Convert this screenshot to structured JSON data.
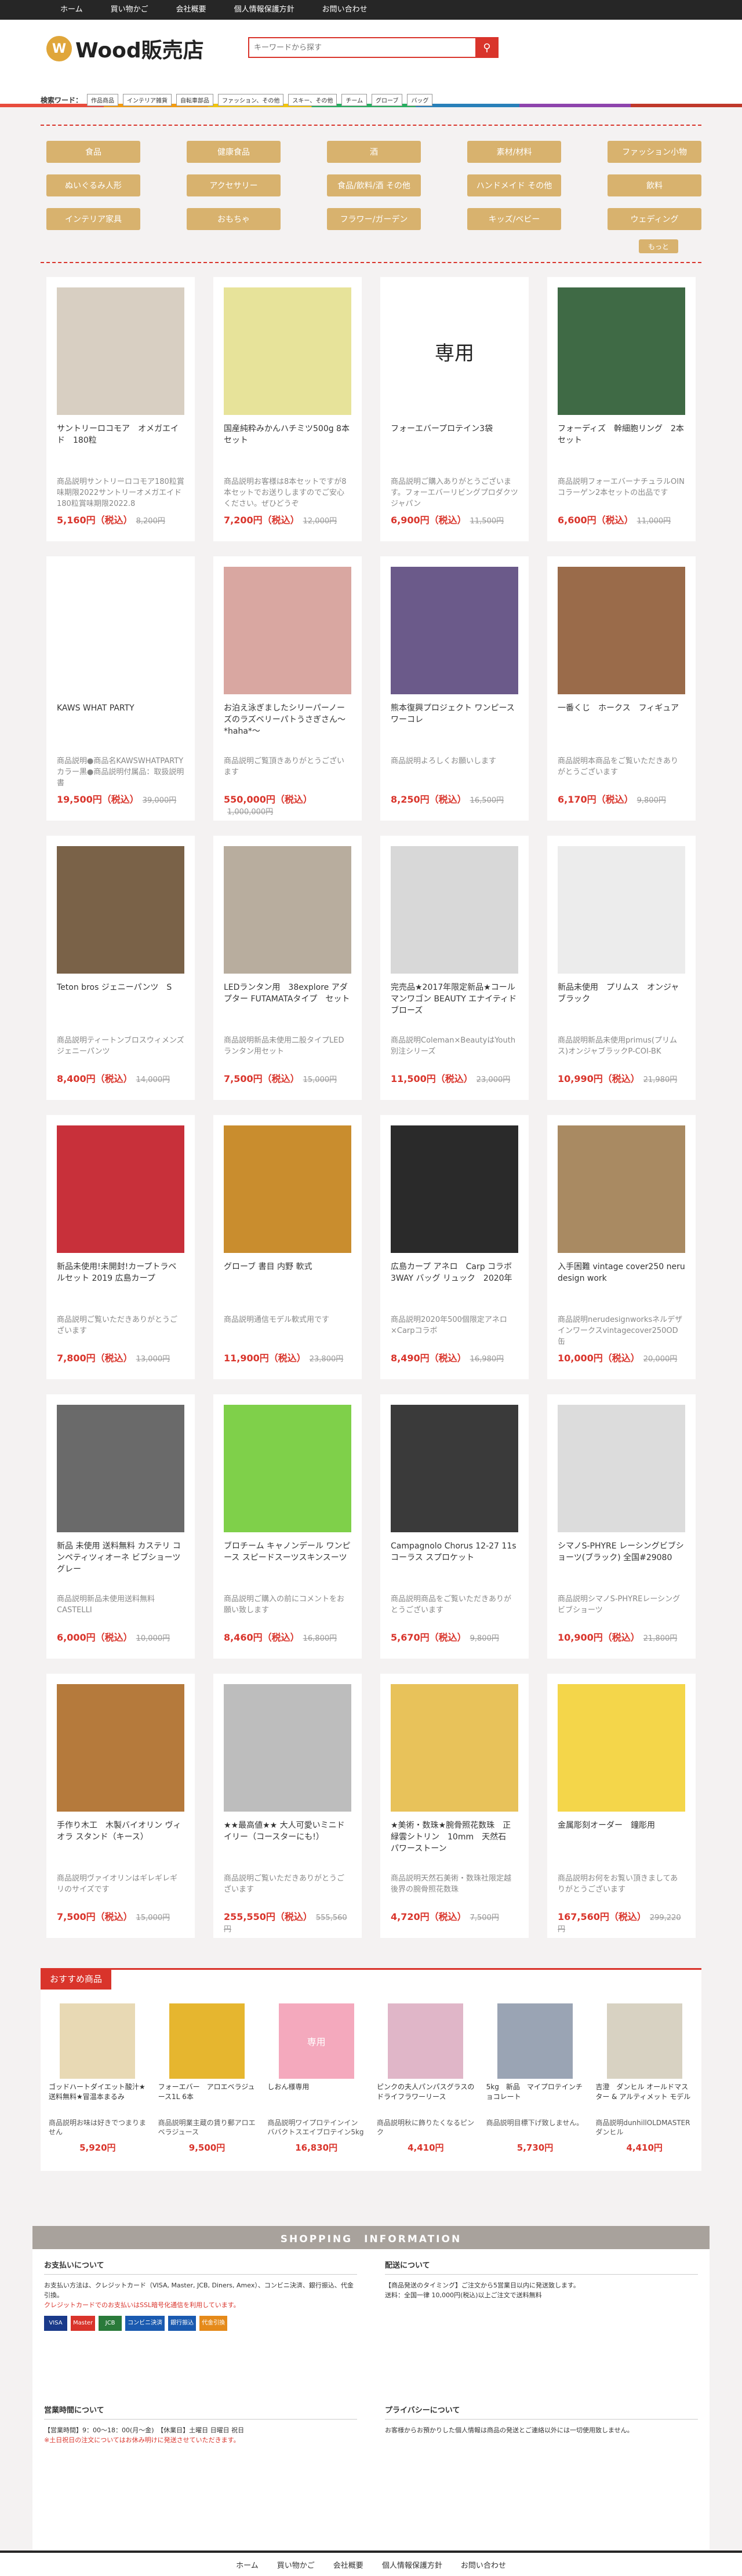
{
  "nav": [
    "ホーム",
    "買い物かご",
    "会社概要",
    "個人情報保護方針",
    "お問い合わせ"
  ],
  "logo": {
    "icon": "W",
    "text": "Wood販売店"
  },
  "search": {
    "placeholder": "キーワードから探す",
    "button_icon": "search-icon"
  },
  "keywords": {
    "label": "検索ワード：",
    "items": [
      "作品商品",
      "インテリア雑貨",
      "自転車部品",
      "ファッション、その他",
      "スキー、その他",
      "チーム",
      "グローブ",
      "バッグ"
    ]
  },
  "categories": [
    "食品",
    "健康食品",
    "酒",
    "素材/材料",
    "ファッション小物",
    "ぬいぐるみ人形",
    "アクセサリー",
    "食品/飲料/酒 その他",
    "ハンドメイド その他",
    "飲料",
    "インテリア家具",
    "おもちゃ",
    "フラワー/ガーデン",
    "キッズ/ベビー",
    "ウェディング"
  ],
  "more_label": "もっと",
  "products": [
    {
      "name": "サントリーロコモア　オメガエイド　180粒",
      "desc": "商品説明サントリーロコモア180粒賞味期限2022サントリーオメガエイド180粒賞味期限2022.8",
      "price": "5,160円（税込）",
      "orig": "8,200円",
      "color": "#d8cfc2"
    },
    {
      "name": "国産純粋みかんハチミツ500g 8本セット",
      "desc": "商品説明お客様は8本セットですが8本セットでお送りしますのでご安心ください。ぜひどうぞ",
      "price": "7,200円（税込）",
      "orig": "12,000円",
      "color": "#e7e39a"
    },
    {
      "name": "フォーエバープロテイン3袋",
      "desc": "商品説明ご購入ありがとうございます。フォーエバーリビングプロダクツジャパン",
      "price": "6,900円（税込）",
      "orig": "11,500円",
      "color": "#ffffff",
      "label": "専用"
    },
    {
      "name": "フォーディズ　幹細胞リング　2本セット",
      "desc": "商品説明フォーエバーナチュラルOINコラーゲン2本セットの出品です",
      "price": "6,600円（税込）",
      "orig": "11,000円",
      "color": "#3f6a45"
    },
    {
      "name": "KAWS WHAT PARTY",
      "desc": "商品説明●商品名KAWSWHATPARTYカラー黒●商品説明付属品：取扱説明書",
      "price": "19,500円（税込）",
      "orig": "39,000円",
      "color": "#ffffff"
    },
    {
      "name": "お泊え泳ぎましたシリーパーノーズのラズベリーパトうさぎさん〜*haha*〜",
      "desc": "商品説明ご覧頂きありがとうございます",
      "price": "550,000円（税込）",
      "orig": "1,000,000円",
      "color": "#d9a7a1"
    },
    {
      "name": "熊本復興プロジェクト ワンピース ワーコレ",
      "desc": "商品説明よろしくお願いします",
      "price": "8,250円（税込）",
      "orig": "16,500円",
      "color": "#6b5a8a"
    },
    {
      "name": "一番くじ　ホークス　フィギュア",
      "desc": "商品説明本商品をご覧いただきありがとうございます",
      "price": "6,170円（税込）",
      "orig": "9,800円",
      "color": "#9a6b4a"
    },
    {
      "name": "Teton bros ジェニーパンツ　S",
      "desc": "商品説明ティートンブロスウィメンズジェニーパンツ",
      "price": "8,400円（税込）",
      "orig": "14,000円",
      "color": "#7a6248"
    },
    {
      "name": "LEDランタン用　38explore アダプター FUTAMATAタイプ　セット",
      "desc": "商品説明新品未使用二股タイプLEDランタン用セット",
      "price": "7,500円（税込）",
      "orig": "15,000円",
      "color": "#b8ad9e"
    },
    {
      "name": "完売品★2017年限定新品★コールマンワゴン BEAUTY エナイティドブローズ",
      "desc": "商品説明Coleman×BeautyはYouth別注シリーズ",
      "price": "11,500円（税込）",
      "orig": "23,000円",
      "color": "#d8d8d8"
    },
    {
      "name": "新品未使用　プリムス　オンジャ　ブラック",
      "desc": "商品説明新品未使用primus(プリムス)オンジャブラックP-COI-BK",
      "price": "10,990円（税込）",
      "orig": "21,980円",
      "color": "#ececec"
    },
    {
      "name": "新品未使用!未開封!カープトラベルセット 2019 広島カープ",
      "desc": "商品説明ご覧いただきありがとうございます",
      "price": "7,800円（税込）",
      "orig": "13,000円",
      "color": "#c8303a"
    },
    {
      "name": "グローブ 書目 内野 軟式",
      "desc": "商品説明通信モデル軟式用です",
      "price": "11,900円（税込）",
      "orig": "23,800円",
      "color": "#c98d2e"
    },
    {
      "name": "広島カープ アネロ　Carp コラボ 3WAY バッグ リュック　2020年",
      "desc": "商品説明2020年500個限定アネロ×Carpコラボ",
      "price": "8,490円（税込）",
      "orig": "16,980円",
      "color": "#2a2a2a"
    },
    {
      "name": "入手困難 vintage cover250 neru design work",
      "desc": "商品説明nerudesignworksネルデザインワークスvintagecover250OD缶",
      "price": "10,000円（税込）",
      "orig": "20,000円",
      "color": "#a98a62"
    },
    {
      "name": "新品 未使用 送料無料 カステリ コンペティツィオーネ ビブショーツ グレー",
      "desc": "商品説明新品未使用送料無料CASTELLI",
      "price": "6,000円（税込）",
      "orig": "10,000円",
      "color": "#6a6a6a"
    },
    {
      "name": "ブロチーム キャノンデール ワンピース スピードスーツスキンスーツ",
      "desc": "商品説明ご購入の前にコメントをお願い致します",
      "price": "8,460円（税込）",
      "orig": "16,800円",
      "color": "#7fd04a"
    },
    {
      "name": "Campagnolo Chorus 12-27 11s コーラス スプロケット",
      "desc": "商品説明商品をご覧いただきありがとうございます",
      "price": "5,670円（税込）",
      "orig": "9,800円",
      "color": "#3a3a3a"
    },
    {
      "name": "シマノS-PHYRE レーシングビブショーツ(ブラック) 全国#29080",
      "desc": "商品説明シマノS-PHYREレーシングビブショーツ",
      "price": "10,900円（税込）",
      "orig": "21,800円",
      "color": "#dcdcdc"
    },
    {
      "name": "手作り木工　木製バイオリン ヴィオラ スタンド（キース）",
      "desc": "商品説明ヴァイオリンはギレギレギリのサイズです",
      "price": "7,500円（税込）",
      "orig": "15,000円",
      "color": "#b57a3c"
    },
    {
      "name": "★★最高値★★ 大人可愛いミニドイリー（コースターにも!）",
      "desc": "商品説明ご覧いただきありがとうございます",
      "price": "255,550円（税込）",
      "orig": "555,560円",
      "color": "#bdbdbd"
    },
    {
      "name": "★美術・数珠★腕骨照花数珠　正緑雲シトリン　10mm　天然石　パワーストーン",
      "desc": "商品説明天然石美術・数珠社限定越後界の腕骨照花数珠",
      "price": "4,720円（税込）",
      "orig": "7,500円",
      "color": "#e8c25a"
    },
    {
      "name": "金属彫刻オーダー　鐘彫用",
      "desc": "商品説明お何をお覧い頂きましてありがとうございます",
      "price": "167,560円（税込）",
      "orig": "299,220円",
      "color": "#f4d64a"
    }
  ],
  "recommend": {
    "tag": "おすすめ商品",
    "items": [
      {
        "name": "ゴッドハートダイエット酸汁★送料無料★冒温本まるみ",
        "desc": "商品説明お味は好きでつまりません",
        "price": "5,920円",
        "color": "#e8d9b4"
      },
      {
        "name": "フォーエバー　アロエベラジュース1L 6本",
        "desc": "商品説明業主蔵の賃り郵アロエベラジュース",
        "price": "9,500円",
        "color": "#e6b62f"
      },
      {
        "name": "しおん様専用",
        "desc": "商品説明ワイプロテインイン ババクトスエイブロテイン5kg",
        "price": "16,830円",
        "color": "#f4a9bd",
        "label": "専用"
      },
      {
        "name": "ピンクの夫人パンパスグラスのドライフラワーリース",
        "desc": "商品説明秋に飾りたくなるピンク",
        "price": "4,410円",
        "color": "#e0b6c8"
      },
      {
        "name": "5kg　新品　マイプロテインチョコレート",
        "desc": "商品説明目標下げ致しません。",
        "price": "5,730円",
        "color": "#9aa4b4"
      },
      {
        "name": "吉澄　ダンヒル オールドマスター & アルティメット モデル",
        "desc": "商品説明dunhillOLDMASTERダンヒル",
        "price": "4,410円",
        "color": "#d8d2c2"
      }
    ]
  },
  "info": {
    "title": "SHOPPING　INFORMATION",
    "payment_title": "お支払いについて",
    "payment_text": "お支払い方法は、クレジットカード（VISA, Master, JCB, Diners, Amex）、コンビニ決済、銀行振込、代金引換。",
    "payment_red": "クレジットカードでのお支払いはSSL暗号化通信を利用しています。",
    "pay_logos": [
      "VISA",
      "Master",
      "JCB",
      "コンビニ決済",
      "銀行振込",
      "代金引換"
    ],
    "delivery_title": "配送について",
    "delivery_text": "【商品発送のタイミング】ご注文から5営業日以内に発送致します。",
    "delivery_text2": "送料：全国一律 10,000円(税込)以上ご注文で送料無料",
    "hours_title": "営業時間について",
    "hours_text": "【営業時間】9：00〜18：00(月〜金)　【休業日】土曜日 日曜日 祝日",
    "hours_red": "※土日祝日の注文についてはお休み明けに発送させていただきます。",
    "privacy_title": "プライバシーについて",
    "privacy_text": "お客様からお預かりした個人情報は商品の発送とご連絡以外には一切使用致しません。"
  },
  "footer": [
    "ホーム",
    "買い物かご",
    "会社概要",
    "個人情報保護方針",
    "お問い合わせ"
  ]
}
